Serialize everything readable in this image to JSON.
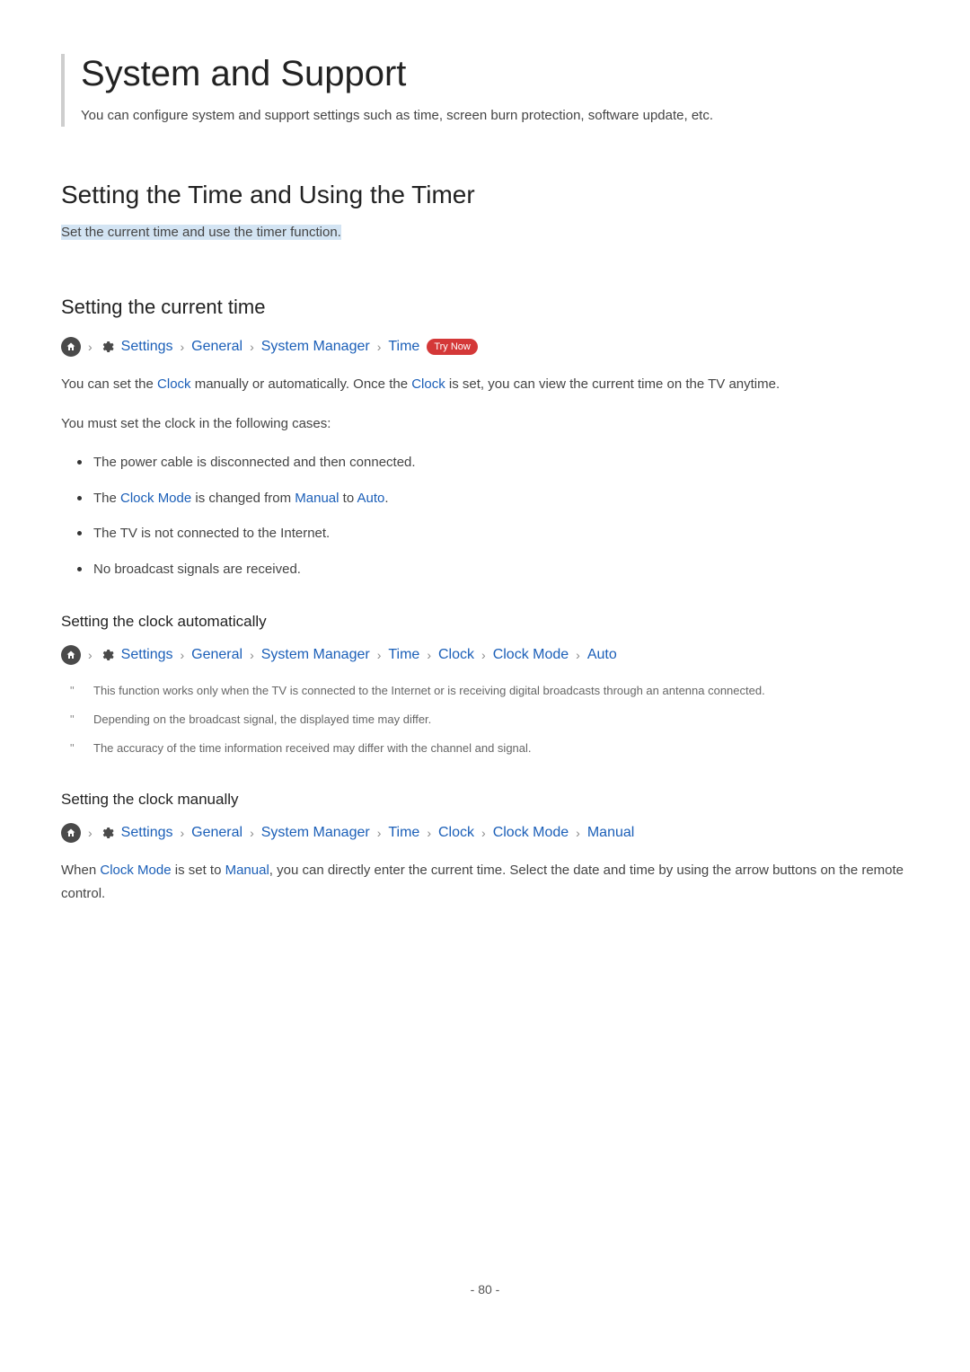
{
  "main": {
    "title": "System and Support",
    "subtitle": "You can configure system and support settings such as time, screen burn protection, software update, etc."
  },
  "section": {
    "title": "Setting the Time and Using the Timer",
    "subtitle": "Set the current time and use the timer function."
  },
  "subsection1": {
    "title": "Setting the current time",
    "breadcrumb": {
      "settings": "Settings",
      "general": "General",
      "system_manager": "System Manager",
      "time": "Time",
      "try_now": "Try Now"
    },
    "para1_pre": "You can set the ",
    "para1_link1": "Clock",
    "para1_mid": " manually or automatically. Once the ",
    "para1_link2": "Clock",
    "para1_post": " is set, you can view the current time on the TV anytime.",
    "para2": "You must set the clock in the following cases:",
    "bullets": {
      "b1": "The power cable is disconnected and then connected.",
      "b2_pre": "The ",
      "b2_link1": "Clock Mode",
      "b2_mid": " is changed from ",
      "b2_link2": "Manual",
      "b2_to": " to ",
      "b2_link3": "Auto",
      "b2_post": ".",
      "b3": "The TV is not connected to the Internet.",
      "b4": "No broadcast signals are received."
    }
  },
  "subsub1": {
    "title": "Setting the clock automatically",
    "breadcrumb": {
      "settings": "Settings",
      "general": "General",
      "system_manager": "System Manager",
      "time": "Time",
      "clock": "Clock",
      "clock_mode": "Clock Mode",
      "auto": "Auto"
    },
    "notes": {
      "n1": "This function works only when the TV is connected to the Internet or is receiving digital broadcasts through an antenna connected.",
      "n2": "Depending on the broadcast signal, the displayed time may differ.",
      "n3": "The accuracy of the time information received may differ with the channel and signal."
    }
  },
  "subsub2": {
    "title": "Setting the clock manually",
    "breadcrumb": {
      "settings": "Settings",
      "general": "General",
      "system_manager": "System Manager",
      "time": "Time",
      "clock": "Clock",
      "clock_mode": "Clock Mode",
      "manual": "Manual"
    },
    "para_pre": "When ",
    "para_link1": "Clock Mode",
    "para_mid": " is set to ",
    "para_link2": "Manual",
    "para_post": ", you can directly enter the current time. Select the date and time by using the arrow buttons on the remote control."
  },
  "page_number": "- 80 -"
}
